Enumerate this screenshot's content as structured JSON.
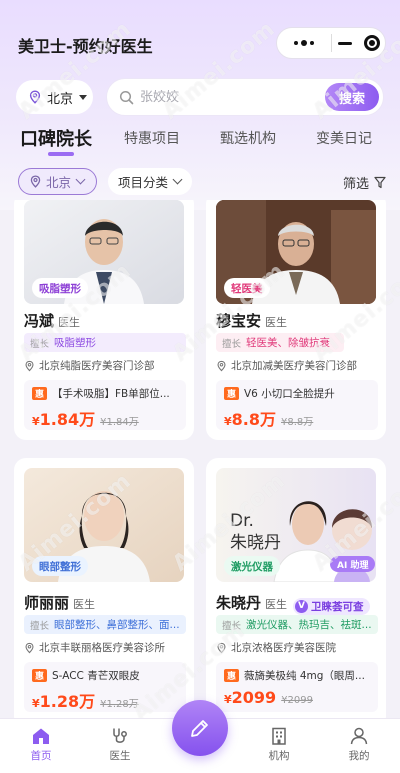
{
  "app": {
    "title": "美卫士-预约好医生"
  },
  "search_bar": {
    "city": "北京",
    "placeholder": "张姣姣",
    "button": "搜索"
  },
  "tabs": [
    {
      "label": "口碑院长",
      "active": true
    },
    {
      "label": "特惠项目",
      "active": false
    },
    {
      "label": "甄选机构",
      "active": false
    },
    {
      "label": "变美日记",
      "active": false
    }
  ],
  "filters": {
    "location": "北京",
    "category": "项目分类",
    "screen": "筛选"
  },
  "doctors": [
    {
      "badge": "吸脂塑形",
      "name": "冯斌",
      "role": "医生",
      "specialty_label": "擅长",
      "specialty": "吸脂塑形",
      "clinic": "北京纯脂医疗美容门诊部",
      "offer_title": "【手术吸脂】FB单部位...",
      "price_currency": "¥",
      "price": "1.84万",
      "orig_price": "¥1.84万",
      "verified": null
    },
    {
      "badge": "轻医美",
      "name": "穆宝安",
      "role": "医生",
      "specialty_label": "擅长",
      "specialty": "轻医美、除皱抗衰",
      "clinic": "北京加减美医疗美容门诊部",
      "offer_title": "V6 小切口全脸提升",
      "price_currency": "¥",
      "price": "8.8万",
      "orig_price": "¥8.8万",
      "verified": null
    },
    {
      "badge": "眼部整形",
      "name": "师丽丽",
      "role": "医生",
      "specialty_label": "擅长",
      "specialty": "眼部整形、鼻部整形、面...",
      "clinic": "北京丰联丽格医疗美容诊所",
      "offer_title": "S-ACC 青芒双眼皮",
      "price_currency": "¥",
      "price": "1.28万",
      "orig_price": "¥1.28万",
      "verified": null
    },
    {
      "badge": "激光仪器",
      "name": "朱晓丹",
      "role": "医生",
      "specialty_label": "擅长",
      "specialty": "激光仪器、热玛吉、祛斑...",
      "clinic": "北京浓格医疗美容医院",
      "offer_title": "薇旖美极纯 4mg（眼周...",
      "price_currency": "¥",
      "price": "2099",
      "orig_price": "¥2099",
      "verified": "卫睐荟可查",
      "photo_text": "Dr.\n朱晓丹",
      "ai_label": "AI 助理"
    }
  ],
  "navbar": [
    {
      "label": "首页",
      "active": true
    },
    {
      "label": "医生",
      "active": false
    },
    {
      "label": "机构",
      "active": false
    },
    {
      "label": "我的",
      "active": false
    }
  ],
  "colors": {
    "accent": "#8d5cf0",
    "price": "#ff4a1a"
  },
  "watermark": "Aimei.com"
}
